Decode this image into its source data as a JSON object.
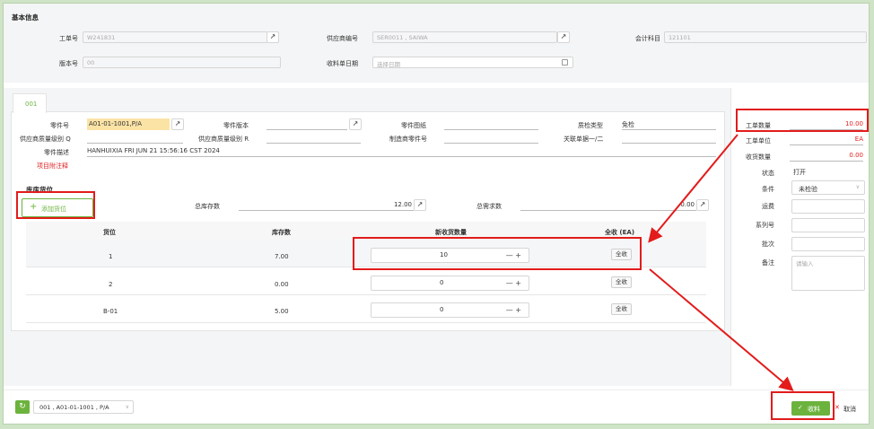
{
  "basic_info": {
    "title": "基本信息",
    "work_order_label": "工单号",
    "work_order_value": "W241831",
    "supplier_label": "供应商编号",
    "supplier_value": "SER0011 , SAIWA",
    "account_label": "会计科目",
    "account_value": "121101",
    "version_label": "版本号",
    "version_value": "00",
    "receipt_date_label": "收料单日期",
    "receipt_date_placeholder": "选择日期"
  },
  "tab": {
    "label": "001"
  },
  "part": {
    "part_no_label": "零件号",
    "part_no_value": "A01-01-1001,P/A",
    "part_version_label": "零件版本",
    "part_drawing_label": "零件图纸",
    "qc_type_label": "质检类型",
    "qc_type_value": "免检",
    "supplier_q_label": "供应商质量级别 Q",
    "supplier_r_label": "供应商质量级别 R",
    "maker_part_label": "制造商零件号",
    "related_doc_label": "关联单据一/二",
    "desc_label": "零件描述",
    "desc_value": "HANHUIXIA FRI JUN 21 15:56:16 CST 2024",
    "note_label": "项目附注释"
  },
  "warehouse": {
    "title": "库房货位",
    "add_button": "添加货位",
    "total_stock_label": "总库存数",
    "total_stock_value": "12.00",
    "total_demand_label": "总需求数",
    "total_demand_value": "0.00",
    "columns": [
      "货位",
      "库存数",
      "新收货数量",
      "全收 (EA)"
    ],
    "rows": [
      {
        "location": "1",
        "stock": "7.00",
        "qty": "10",
        "action": "全收"
      },
      {
        "location": "2",
        "stock": "0.00",
        "qty": "0",
        "action": "全收"
      },
      {
        "location": "B-01",
        "stock": "5.00",
        "qty": "0",
        "action": "全收"
      }
    ],
    "stepper_symbols": "— +"
  },
  "side": {
    "work_qty_label": "工单数量",
    "work_qty_value": "10.00",
    "work_unit_label": "工单单位",
    "work_unit_value": "EA",
    "received_qty_label": "收货数量",
    "received_qty_value": "0.00",
    "status_label": "状态",
    "status_value": "打开",
    "condition_label": "条件",
    "condition_value": "未检验",
    "freight_label": "运费",
    "serial_label": "系列号",
    "batch_label": "批次",
    "remark_label": "备注",
    "remark_placeholder": "请输入"
  },
  "footer": {
    "selector_value": "001 , A01-01-1001 , P/A",
    "receive_button": "收料",
    "cancel_button": "取消"
  },
  "colors": {
    "accent_green": "#6cb33e",
    "annotation_red": "#e31b1b"
  }
}
